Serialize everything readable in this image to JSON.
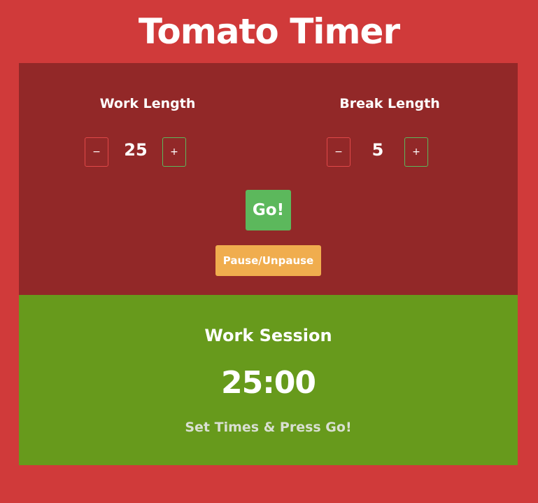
{
  "app": {
    "title": "Tomato Timer"
  },
  "work": {
    "label": "Work Length",
    "value": "25",
    "decrement_label": "−",
    "increment_label": "+"
  },
  "break": {
    "label": "Break Length",
    "value": "5",
    "decrement_label": "−",
    "increment_label": "+"
  },
  "controls": {
    "go_label": "Go!",
    "pause_label": "Pause/Unpause"
  },
  "session": {
    "title": "Work Session",
    "time": "25:00",
    "status": "Set Times & Press Go!"
  },
  "colors": {
    "background": "#d03a3a",
    "settings_panel": "#922828",
    "session_panel": "#679a1c",
    "go_button": "#5cb85c",
    "pause_button": "#f0ad4e",
    "minus_border": "#e04848",
    "plus_border": "#5cb85c"
  }
}
